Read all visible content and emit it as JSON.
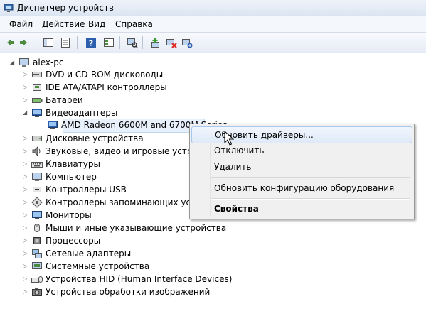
{
  "window": {
    "title": "Диспетчер устройств"
  },
  "menu": [
    "Файл",
    "Действие",
    "Вид",
    "Справка"
  ],
  "tree": {
    "root": "alex-pc",
    "items": [
      "DVD и CD-ROM дисководы",
      "IDE ATA/ATAPI контроллеры",
      "Батареи",
      "Видеоадаптеры",
      "AMD Radeon 6600M and 6700M Series",
      "Дисковые устройства",
      "Звуковые, видео и игровые устройства",
      "Клавиатуры",
      "Компьютер",
      "Контроллеры USB",
      "Контроллеры запоминающих устройств",
      "Мониторы",
      "Мыши и иные указывающие устройства",
      "Процессоры",
      "Сетевые адаптеры",
      "Системные устройства",
      "Устройства HID (Human Interface Devices)",
      "Устройства обработки изображений"
    ]
  },
  "context_menu": {
    "update_drivers": "Обновить драйверы...",
    "disable": "Отключить",
    "uninstall": "Удалить",
    "scan_hardware": "Обновить конфигурацию оборудования",
    "properties": "Свойства"
  },
  "colors": {
    "selection": "#e8f1fb",
    "menu_bg": "#f0f0f0",
    "hover_border": "#a8c7ee"
  }
}
